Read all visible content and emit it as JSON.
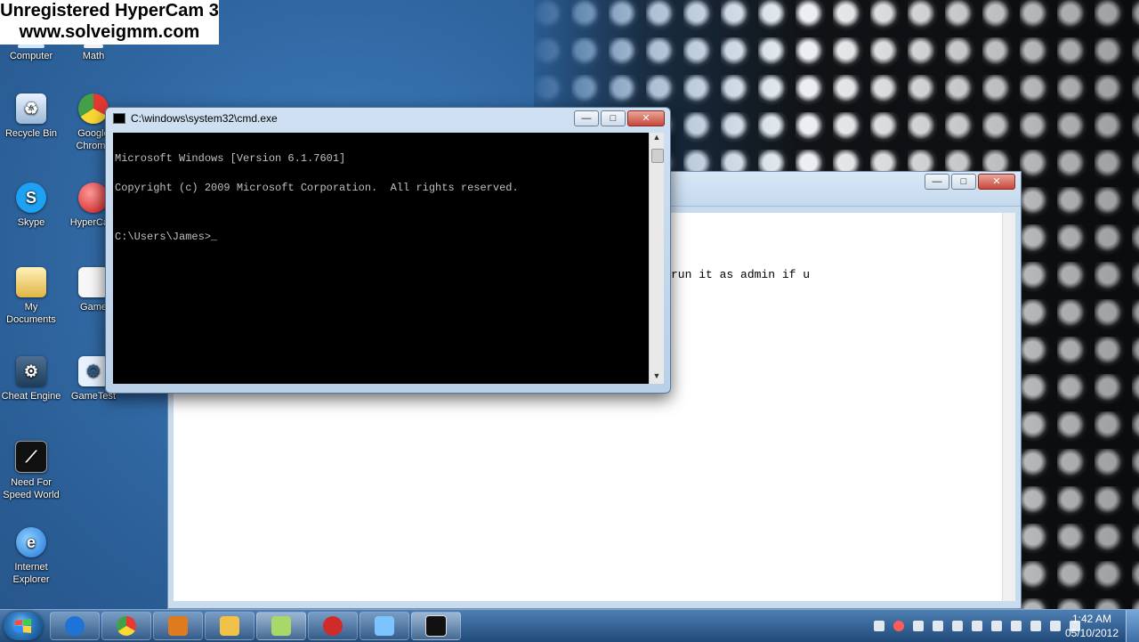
{
  "overlay": {
    "line1": "Unregistered HyperCam 3",
    "line2": "www.solveigmm.com"
  },
  "desktop": {
    "icons": [
      {
        "label": "Computer",
        "icon": "computer-icon"
      },
      {
        "label": "Math",
        "icon": "file-icon"
      },
      {
        "label": "Recycle Bin",
        "icon": "recycle-bin-icon"
      },
      {
        "label": "Google Chrome",
        "icon": "chrome-icon"
      },
      {
        "label": "Skype",
        "icon": "skype-icon"
      },
      {
        "label": "HyperCam",
        "icon": "hypercam-icon"
      },
      {
        "label": "My Documents",
        "icon": "folder-icon"
      },
      {
        "label": "Game",
        "icon": "file-icon"
      },
      {
        "label": "Cheat Engine",
        "icon": "cheat-engine-icon"
      },
      {
        "label": "GameTest",
        "icon": "settings-file-icon"
      },
      {
        "label": "Need For Speed World",
        "icon": "game-icon"
      },
      {
        "label": "Internet Explorer",
        "icon": "internet-explorer-icon"
      }
    ]
  },
  "background_window": {
    "visible_text": "run it as admin if u"
  },
  "cmd": {
    "title": "C:\\windows\\system32\\cmd.exe",
    "controls": {
      "minimize": "—",
      "maximize": "□",
      "close": "✕"
    },
    "lines": [
      "Microsoft Windows [Version 6.1.7601]",
      "Copyright (c) 2009 Microsoft Corporation.  All rights reserved.",
      "",
      "C:\\Users\\James>_"
    ]
  },
  "taskbar": {
    "pinned": [
      {
        "name": "internet-explorer",
        "icon": "internet-explorer-icon",
        "color": "#1e73d8"
      },
      {
        "name": "chrome",
        "icon": "chrome-icon",
        "color": "#2aa84a"
      },
      {
        "name": "media-player",
        "icon": "media-player-icon",
        "color": "#e07a1f"
      },
      {
        "name": "explorer",
        "icon": "folder-icon",
        "color": "#f0c24a"
      },
      {
        "name": "sticky-notes",
        "icon": "note-icon",
        "color": "#a8d86a"
      },
      {
        "name": "hypercam",
        "icon": "record-icon",
        "color": "#d02a2a"
      },
      {
        "name": "notepad",
        "icon": "notepad-icon",
        "color": "#7cc3ff"
      },
      {
        "name": "cmd",
        "icon": "terminal-icon",
        "color": "#111111"
      }
    ],
    "clock": {
      "time": "1:42 AM",
      "date": "05/10/2012"
    }
  }
}
